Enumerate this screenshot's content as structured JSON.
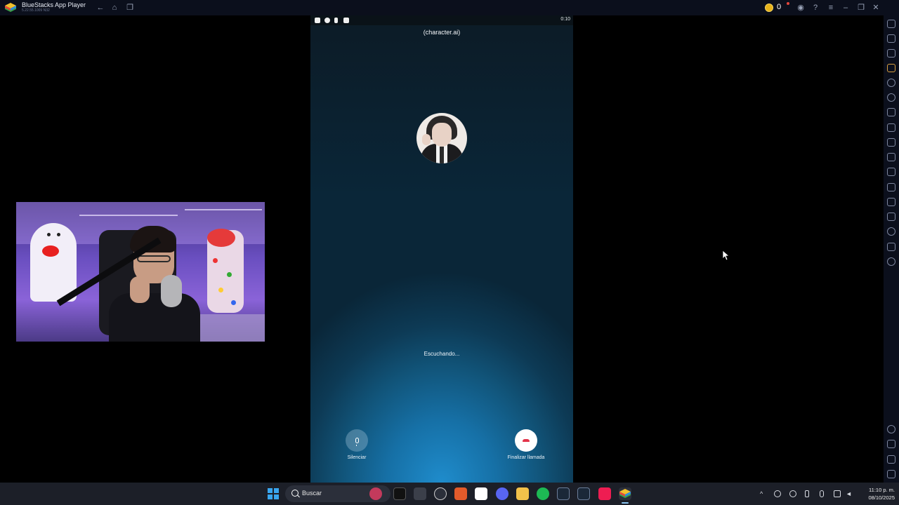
{
  "window": {
    "title": "BlueStacks App Player",
    "version": "5.22.55.1009  N32",
    "coin_count": "0"
  },
  "phone": {
    "status_time": "0:10",
    "call_title": "(character.ai)",
    "status_text": "Escuchando...",
    "mute_label": "Silenciar",
    "end_call_label": "Finalizar llamada",
    "accent_end_call": "#e3344a"
  },
  "taskbar": {
    "search_label": "Buscar",
    "clock_time": "11:10 p. m.",
    "clock_date": "08/10/2025"
  },
  "colors": {
    "titlebar_bg": "#0b0f1c",
    "phone_gradient_bottom": "#1f8ccc",
    "coin": "#e7b21a"
  }
}
